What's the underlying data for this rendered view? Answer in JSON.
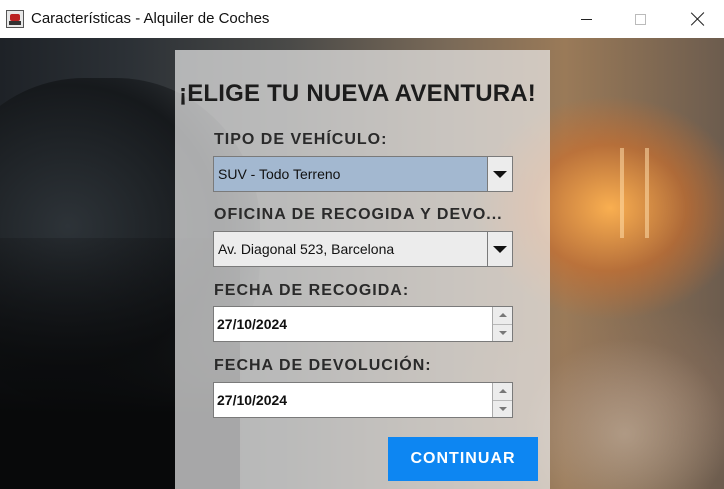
{
  "window": {
    "title": "Características - Alquiler de Coches",
    "icon": "car-app-icon",
    "controls": [
      "minimize",
      "maximize",
      "close"
    ]
  },
  "form": {
    "heading": "¡ELIGE TU NUEVA AVENTURA!",
    "vehicle_type": {
      "label": "TIPO DE VEHÍCULO:",
      "selected": "SUV - Todo Terreno"
    },
    "pickup_office": {
      "label": "OFICINA DE RECOGIDA Y DEVO...",
      "selected": "Av. Diagonal 523, Barcelona"
    },
    "pickup_date": {
      "label": "FECHA DE RECOGIDA:",
      "value": "27/10/2024"
    },
    "return_date": {
      "label": "FECHA DE DEVOLUCIÓN:",
      "value": "27/10/2024"
    },
    "continue_label": "CONTINUAR"
  },
  "colors": {
    "accent_button": "#0d86f2",
    "selected_combo": "#a3b8d0"
  }
}
